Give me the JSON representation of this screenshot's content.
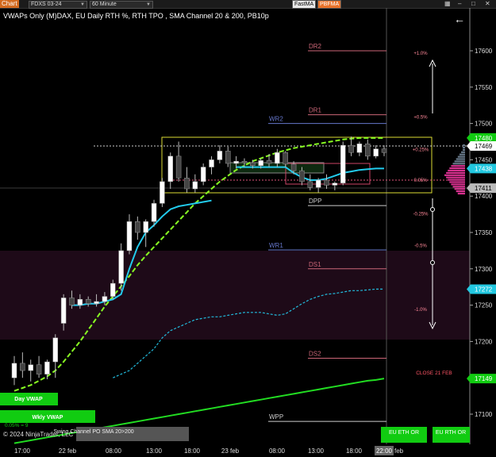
{
  "toolbar": {
    "chart_label": "Chart",
    "instrument": "FDXS 03-24",
    "interval": "60 Minute",
    "fastma_label": "FastMA",
    "pbfma_label": "PBFMA",
    "icons": [
      "grid-icon",
      "minimize-icon",
      "restore-icon",
      "close-icon"
    ]
  },
  "header_text": "VWAPs Only (M)DAX, EU Daily RTH %, RTH TPO , SMA Channel 20 & 200, PB10p",
  "copyright": "© 2024 NinjaTrader, LLC",
  "colors": {
    "background": "#000000",
    "bull_candle": "#ffffff",
    "bear_candle": "#444444",
    "sma20": "#88ff22",
    "sma200": "#22dd22",
    "vwap": "#22ccee",
    "ds_zone": "#1e0a18",
    "level_line": "#cc6677",
    "tag_green": "#11cc11",
    "tag_cyan": "#22c8e0"
  },
  "chart_data": {
    "type": "candlestick",
    "y_axis": {
      "ticks": [
        17100,
        17150,
        17200,
        17250,
        17300,
        17350,
        17400,
        17450,
        17500,
        17550,
        17600
      ]
    },
    "x_axis": {
      "tick_labels": [
        "17:00",
        "22 feb",
        "08:00",
        "13:00",
        "18:00",
        "23 feb",
        "08:00",
        "13:00",
        "18:00",
        "26 feb"
      ],
      "highlight_label": "22:00"
    },
    "price_tags": [
      {
        "value": 17480,
        "label": "17480",
        "color": "#11cc11"
      },
      {
        "value": 17469,
        "label": "17469",
        "color": "#ffffff"
      },
      {
        "value": 17438,
        "label": "17438",
        "color": "#22c8e0"
      },
      {
        "value": 17411,
        "label": "17411",
        "color": "#bbbbbb"
      },
      {
        "value": 17272,
        "label": "17272",
        "color": "#22c8e0"
      },
      {
        "value": 17149,
        "label": "17149",
        "color": "#11cc11"
      }
    ],
    "levels": [
      {
        "label": "DR2",
        "value": 17600
      },
      {
        "label": "DR1",
        "value": 17512
      },
      {
        "label": "WR2",
        "value": 17500
      },
      {
        "label": "DPP",
        "value": 17387
      },
      {
        "label": "WR1",
        "value": 17326
      },
      {
        "label": "DS1",
        "value": 17300
      },
      {
        "label": "DS2",
        "value": 17177
      },
      {
        "label": "WPP",
        "value": 17090
      }
    ],
    "percent_labels": [
      {
        "label": "+1.0%",
        "value": 17598
      },
      {
        "label": "+0.5%",
        "value": 17510
      },
      {
        "label": "+0.25%",
        "value": 17465
      },
      {
        "label": "0.05%",
        "value": 17423
      },
      {
        "label": "-0.25%",
        "value": 17377
      },
      {
        "label": "-0.5%",
        "value": 17333
      },
      {
        "label": "-1.0%",
        "value": 17245
      }
    ],
    "close_label": "CLOSE 21 FEB",
    "left_labels": [
      "Day VWAP",
      "Wkly VWAP",
      "Swing Channel PO SMA 20>200",
      "0.05% = 9"
    ],
    "bottom_buttons": [
      "EU ETH OR",
      "EU RTH OR"
    ],
    "candles": [
      {
        "o": 17150,
        "h": 17180,
        "l": 17140,
        "c": 17170
      },
      {
        "o": 17170,
        "h": 17185,
        "l": 17150,
        "c": 17160
      },
      {
        "o": 17160,
        "h": 17175,
        "l": 17145,
        "c": 17168
      },
      {
        "o": 17168,
        "h": 17180,
        "l": 17150,
        "c": 17155
      },
      {
        "o": 17155,
        "h": 17175,
        "l": 17148,
        "c": 17172
      },
      {
        "o": 17172,
        "h": 17210,
        "l": 17150,
        "c": 17205
      },
      {
        "o": 17225,
        "h": 17265,
        "l": 17215,
        "c": 17260
      },
      {
        "o": 17260,
        "h": 17270,
        "l": 17245,
        "c": 17250
      },
      {
        "o": 17250,
        "h": 17265,
        "l": 17245,
        "c": 17258
      },
      {
        "o": 17258,
        "h": 17262,
        "l": 17248,
        "c": 17252
      },
      {
        "o": 17252,
        "h": 17265,
        "l": 17248,
        "c": 17255
      },
      {
        "o": 17255,
        "h": 17268,
        "l": 17250,
        "c": 17262
      },
      {
        "o": 17262,
        "h": 17285,
        "l": 17258,
        "c": 17280
      },
      {
        "o": 17280,
        "h": 17335,
        "l": 17270,
        "c": 17325
      },
      {
        "o": 17325,
        "h": 17375,
        "l": 17320,
        "c": 17365
      },
      {
        "o": 17365,
        "h": 17372,
        "l": 17340,
        "c": 17350
      },
      {
        "o": 17350,
        "h": 17368,
        "l": 17330,
        "c": 17365
      },
      {
        "o": 17365,
        "h": 17395,
        "l": 17358,
        "c": 17390
      },
      {
        "o": 17390,
        "h": 17425,
        "l": 17385,
        "c": 17420
      },
      {
        "o": 17420,
        "h": 17460,
        "l": 17410,
        "c": 17455
      },
      {
        "o": 17455,
        "h": 17475,
        "l": 17420,
        "c": 17425
      },
      {
        "o": 17425,
        "h": 17440,
        "l": 17405,
        "c": 17410
      },
      {
        "o": 17410,
        "h": 17430,
        "l": 17405,
        "c": 17420
      },
      {
        "o": 17420,
        "h": 17445,
        "l": 17415,
        "c": 17440
      },
      {
        "o": 17440,
        "h": 17455,
        "l": 17430,
        "c": 17450
      },
      {
        "o": 17450,
        "h": 17470,
        "l": 17445,
        "c": 17462
      },
      {
        "o": 17462,
        "h": 17468,
        "l": 17440,
        "c": 17445
      },
      {
        "o": 17445,
        "h": 17455,
        "l": 17438,
        "c": 17448
      },
      {
        "o": 17448,
        "h": 17452,
        "l": 17440,
        "c": 17446
      },
      {
        "o": 17446,
        "h": 17450,
        "l": 17438,
        "c": 17442
      },
      {
        "o": 17442,
        "h": 17452,
        "l": 17438,
        "c": 17449
      },
      {
        "o": 17449,
        "h": 17458,
        "l": 17440,
        "c": 17445
      },
      {
        "o": 17445,
        "h": 17465,
        "l": 17440,
        "c": 17460
      },
      {
        "o": 17460,
        "h": 17462,
        "l": 17440,
        "c": 17444
      },
      {
        "o": 17444,
        "h": 17448,
        "l": 17430,
        "c": 17435
      },
      {
        "o": 17435,
        "h": 17440,
        "l": 17415,
        "c": 17420
      },
      {
        "o": 17420,
        "h": 17430,
        "l": 17408,
        "c": 17412
      },
      {
        "o": 17412,
        "h": 17425,
        "l": 17405,
        "c": 17422
      },
      {
        "o": 17422,
        "h": 17430,
        "l": 17410,
        "c": 17415
      },
      {
        "o": 17415,
        "h": 17420,
        "l": 17408,
        "c": 17418
      },
      {
        "o": 17418,
        "h": 17475,
        "l": 17415,
        "c": 17470
      },
      {
        "o": 17470,
        "h": 17482,
        "l": 17455,
        "c": 17460
      },
      {
        "o": 17460,
        "h": 17475,
        "l": 17455,
        "c": 17472
      },
      {
        "o": 17472,
        "h": 17478,
        "l": 17450,
        "c": 17455
      },
      {
        "o": 17455,
        "h": 17470,
        "l": 17452,
        "c": 17465
      },
      {
        "o": 17465,
        "h": 17470,
        "l": 17455,
        "c": 17460
      }
    ],
    "sma20": [
      17132,
      17136,
      17140,
      17146,
      17152,
      17160,
      17172,
      17186,
      17200,
      17216,
      17232,
      17248,
      17262,
      17276,
      17290,
      17305,
      17318,
      17330,
      17342,
      17354,
      17366,
      17378,
      17390,
      17400,
      17410,
      17420,
      17428,
      17436,
      17442,
      17448,
      17452,
      17456,
      17460,
      17463,
      17466,
      17468,
      17470,
      17472,
      17474,
      17476,
      17478,
      17479,
      17480,
      17480,
      17480,
      17480
    ],
    "sma200": [
      17060,
      17062,
      17064,
      17066,
      17068,
      17070,
      17072,
      17074,
      17076,
      17078,
      17080,
      17082,
      17084,
      17086,
      17088,
      17090,
      17092,
      17094,
      17096,
      17098,
      17100,
      17102,
      17104,
      17106,
      17108,
      17110,
      17112,
      17114,
      17116,
      17118,
      17120,
      17122,
      17124,
      17126,
      17128,
      17130,
      17132,
      17134,
      17136,
      17138,
      17140,
      17142,
      17144,
      17146,
      17147,
      17149
    ],
    "channel_lower": [
      null,
      null,
      null,
      null,
      null,
      null,
      null,
      null,
      null,
      null,
      null,
      null,
      17150,
      17155,
      17160,
      17170,
      17180,
      17190,
      17205,
      17215,
      17220,
      17225,
      17230,
      17232,
      17234,
      17234,
      17236,
      17238,
      17240,
      17240,
      17240,
      17238,
      17236,
      17238,
      17245,
      17252,
      17258,
      17262,
      17265,
      17266,
      17268,
      17270,
      17270,
      17271,
      17272,
      17272
    ],
    "vwap": [
      null,
      null,
      null,
      null,
      null,
      null,
      null,
      17250,
      17250,
      17252,
      17252,
      17255,
      17258,
      17265,
      17300,
      17330,
      17350,
      17360,
      17372,
      17382,
      17386,
      17388,
      17390,
      17392,
      17394,
      null,
      null,
      17440,
      17440,
      17440,
      17440,
      17440,
      17440,
      17440,
      17432,
      17426,
      17422,
      17422,
      17424,
      17428,
      17432,
      17434,
      17436,
      17437,
      17438,
      17438
    ]
  }
}
